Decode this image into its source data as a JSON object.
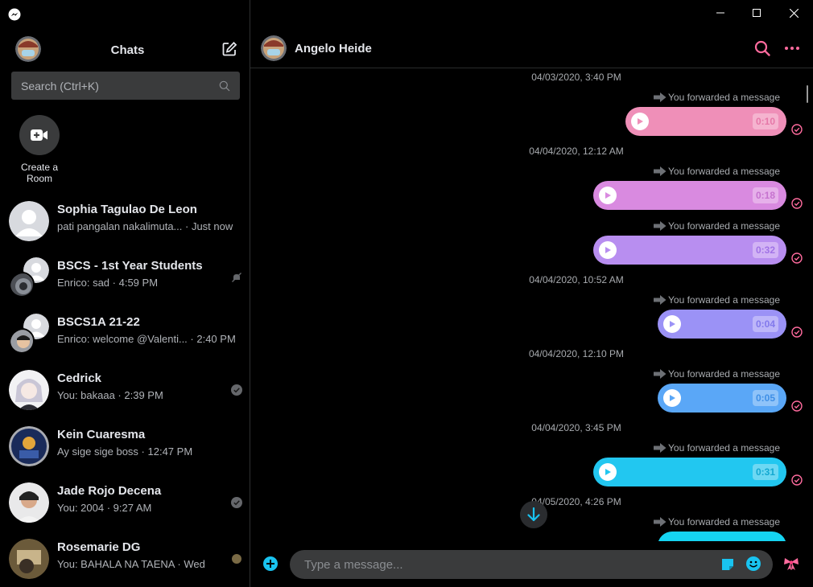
{
  "window": {
    "minimize_glyph": "—",
    "maximize_glyph": "☐",
    "close_glyph": "✕"
  },
  "sidebar": {
    "title": "Chats",
    "search_placeholder": "Search (Ctrl+K)",
    "create_room_label": "Create a Room",
    "chats": [
      {
        "name": "Sophia Tagulao De Leon",
        "preview": "pati pangalan nakalimuta...",
        "time": "Just now",
        "status": "none"
      },
      {
        "name": "BSCS - 1st Year Students",
        "preview": "Enrico: sad",
        "time": "4:59 PM",
        "status": "muted"
      },
      {
        "name": "BSCS1A 21-22",
        "preview": "Enrico: welcome @Valenti...",
        "time": "2:40 PM",
        "status": "none"
      },
      {
        "name": "Cedrick",
        "preview": "You: bakaaa",
        "time": "2:39 PM",
        "status": "sent"
      },
      {
        "name": "Kein Cuaresma",
        "preview": "Ay sige sige boss",
        "time": "12:47 PM",
        "status": "none"
      },
      {
        "name": "Jade Rojo Decena",
        "preview": "You: 2004",
        "time": "9:27 AM",
        "status": "sent"
      },
      {
        "name": "Rosemarie DG",
        "preview": "You: BAHALA NA TAENA",
        "time": "Wed",
        "status": "seen"
      }
    ]
  },
  "conversation": {
    "contact_name": "Angelo Heide",
    "forward_label": "You forwarded a message",
    "timestamps": [
      "04/03/2020, 3:40 PM",
      "04/04/2020, 12:12 AM",
      "04/04/2020, 10:52 AM",
      "04/04/2020, 12:10 PM",
      "04/04/2020, 3:45 PM",
      "04/05/2020, 4:26 PM"
    ],
    "voice_messages": [
      {
        "duration": "0:10",
        "color": "#ef8fb8"
      },
      {
        "duration": "0:18",
        "color": "#d98ae0"
      },
      {
        "duration": "0:32",
        "color": "#b88ef0"
      },
      {
        "duration": "0:04",
        "color": "#9b92f6"
      },
      {
        "duration": "0:05",
        "color": "#5aa7f7"
      },
      {
        "duration": "0:31",
        "color": "#22c7f0"
      }
    ]
  },
  "composer": {
    "placeholder": "Type a message..."
  },
  "colors": {
    "accent": "#ff6b9e",
    "composer_accent": "#19c3f0",
    "background": "#000000",
    "input_bg": "#3a3b3c"
  },
  "icons": [
    "messenger-logo-icon",
    "compose-icon",
    "search-icon",
    "video-plus-icon",
    "muted-bell-icon",
    "check-circle-icon",
    "play-icon",
    "forward-arrow-icon",
    "more-icon",
    "arrow-down-icon",
    "plus-circle-icon",
    "sticker-icon",
    "emoji-icon",
    "bow-icon"
  ]
}
